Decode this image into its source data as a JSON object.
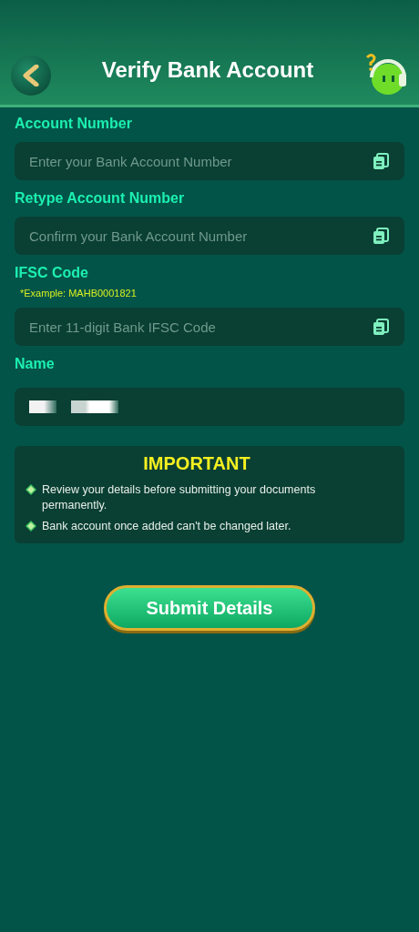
{
  "header": {
    "title": "Verify Bank Account"
  },
  "fields": [
    {
      "kind": "input",
      "label": "Account Number",
      "placeholder": "Enter your Bank Account Number"
    },
    {
      "kind": "input",
      "label": "Retype Account Number",
      "placeholder": "Confirm your Bank Account Number"
    },
    {
      "kind": "input",
      "label": "IFSC Code",
      "hint": "*Example: MAHB0001821",
      "placeholder": "Enter 11-digit Bank IFSC Code"
    },
    {
      "kind": "redacted",
      "label": "Name"
    }
  ],
  "notice": {
    "title": "IMPORTANT",
    "items": [
      "Review your details before submitting your documents permanently.",
      "Bank account once added can't be changed later."
    ]
  },
  "submit": {
    "label": "Submit Details"
  }
}
